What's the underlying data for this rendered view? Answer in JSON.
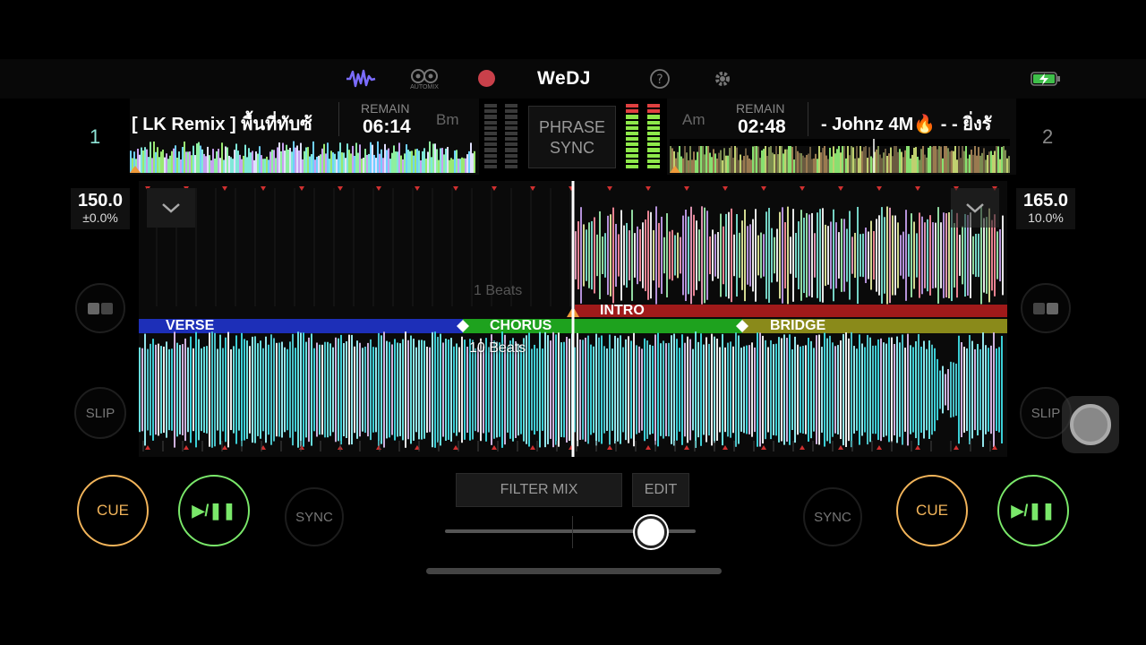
{
  "topbar": {
    "logo": "WeDJ",
    "automix_label": "AUTOMIX",
    "icons": [
      "waveform-icon",
      "automix-icon",
      "record-icon",
      "help-icon",
      "gear-icon",
      "battery-icon"
    ]
  },
  "deck1": {
    "number": "1",
    "title": "[ LK Remix ] พื้นที่ทับซ้",
    "remain_label": "REMAIN",
    "remain": "06:14",
    "key": "Bm",
    "bpm": "150.0",
    "pitch": "±0.0%",
    "slip": "SLIP",
    "cue": "CUE",
    "play": "▶/❚❚",
    "sync": "SYNC"
  },
  "deck2": {
    "number": "2",
    "title": "- Johnz 4M🔥 - - ยิ่งรั",
    "remain_label": "REMAIN",
    "remain": "02:48",
    "key": "Am",
    "bpm": "165.0",
    "pitch": "10.0%",
    "slip": "SLIP",
    "cue": "CUE",
    "play": "▶/❚❚",
    "sync": "SYNC"
  },
  "center": {
    "phrase_sync_line1": "PHRASE",
    "phrase_sync_line2": "SYNC",
    "filter_mix": "FILTER MIX",
    "edit": "EDIT",
    "crossfader": 0.82
  },
  "waveform": {
    "top_beats": "1 Beats",
    "bottom_beats": "10 Beats",
    "phrases_top": [
      "INTRO"
    ],
    "phrases_bottom": [
      "VERSE",
      "CHORUS",
      "BRIDGE"
    ]
  },
  "colors": {
    "cue": "#f2b45a",
    "play": "#7ae86a",
    "verse": "#1d2fb8",
    "chorus": "#1ea21e",
    "intro": "#a01a1a",
    "bridge": "#8a8a1a",
    "accent": "#7b6cff"
  }
}
